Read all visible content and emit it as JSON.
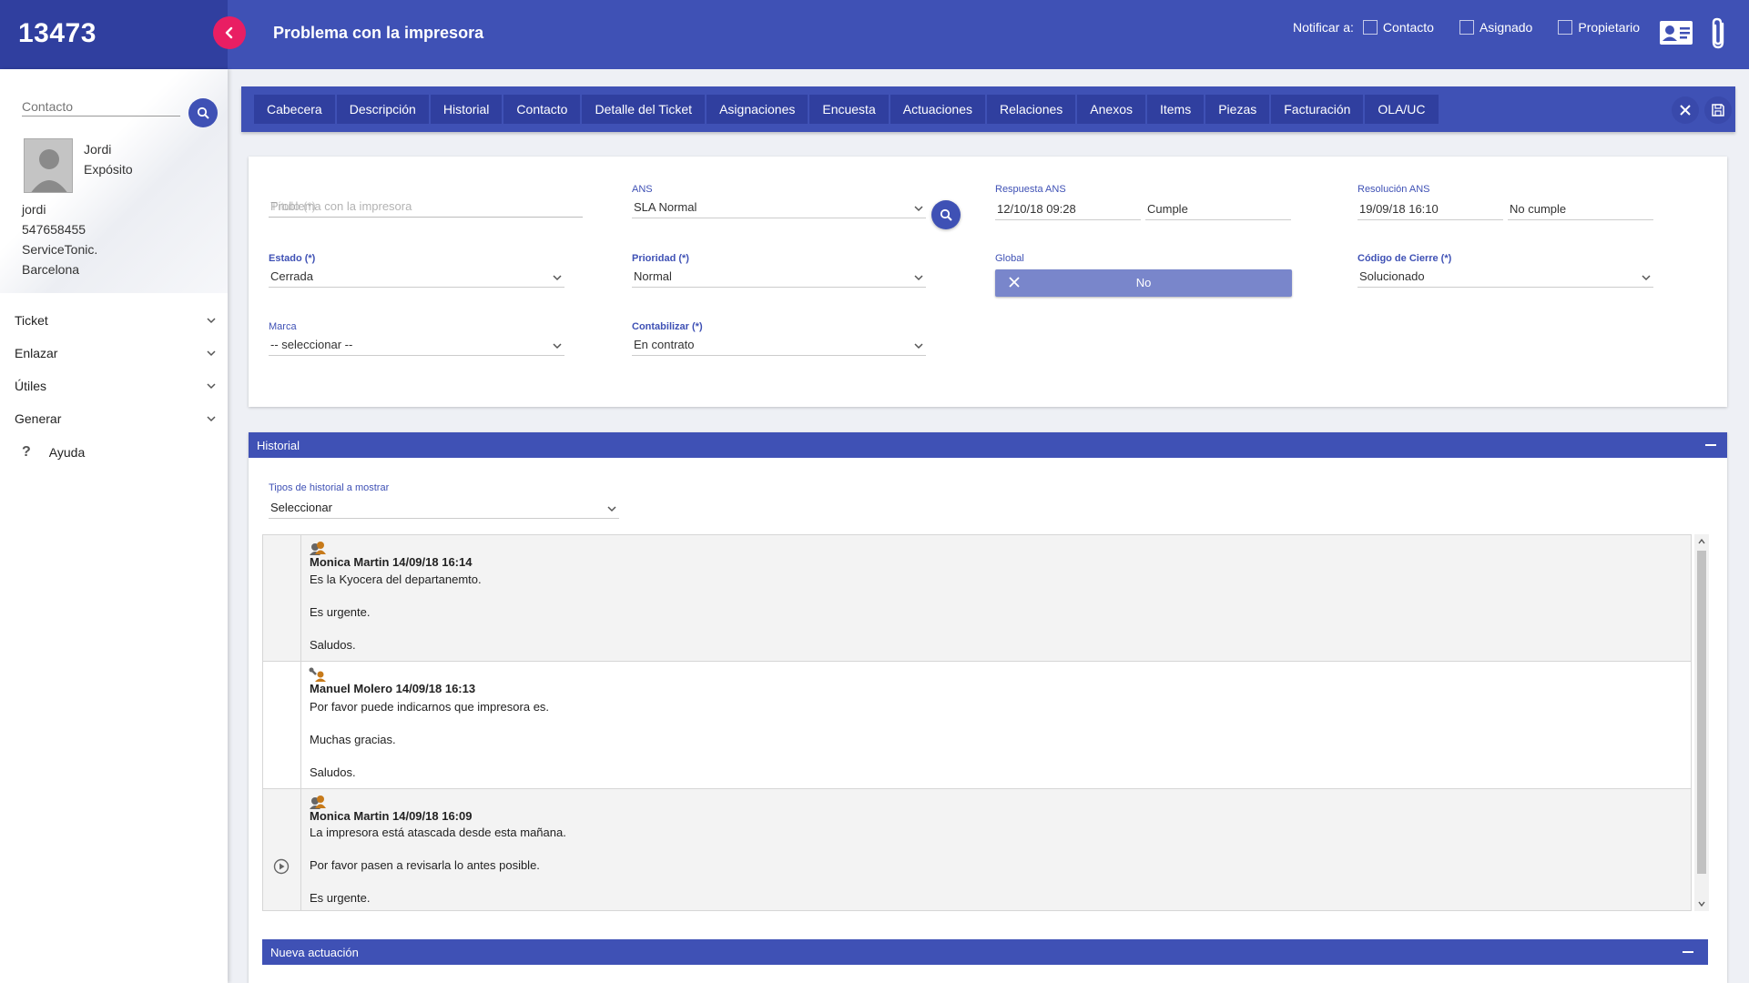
{
  "header": {
    "ticket_number": "13473",
    "title": "Problema con la impresora",
    "notify_label": "Notificar a:",
    "notify_options": [
      {
        "label": "Contacto",
        "checked": false
      },
      {
        "label": "Asignado",
        "checked": false
      },
      {
        "label": "Propietario",
        "checked": false
      }
    ]
  },
  "sidebar": {
    "contact_placeholder": "Contacto",
    "contact": {
      "first_name": "Jordi",
      "last_name": "Expósito",
      "username": "jordi",
      "phone": "547658455",
      "company": "ServiceTonic.",
      "city": "Barcelona"
    },
    "menu": [
      "Ticket",
      "Enlazar",
      "Útiles",
      "Generar"
    ],
    "help_label": "Ayuda"
  },
  "tabs": [
    "Cabecera",
    "Descripción",
    "Historial",
    "Contacto",
    "Detalle del Ticket",
    "Asignaciones",
    "Encuesta",
    "Actuaciones",
    "Relaciones",
    "Anexos",
    "Items",
    "Piezas",
    "Facturación",
    "OLA/UC"
  ],
  "form": {
    "titulo_label": "Título (*)",
    "titulo_value": "Problema con la impresora",
    "ans_label": "ANS",
    "ans_value": "SLA Normal",
    "respuesta_label": "Respuesta ANS",
    "respuesta_date": "12/10/18 09:28",
    "respuesta_status": "Cumple",
    "resolucion_label": "Resolución ANS",
    "resolucion_date": "19/09/18 16:10",
    "resolucion_status": "No cumple",
    "estado_label": "Estado (*)",
    "estado_value": "Cerrada",
    "prioridad_label": "Prioridad (*)",
    "prioridad_value": "Normal",
    "global_label": "Global",
    "global_value": "No",
    "cierre_label": "Código de Cierre (*)",
    "cierre_value": "Solucionado",
    "marca_label": "Marca",
    "marca_value": "-- seleccionar --",
    "contabilizar_label": "Contabilizar (*)",
    "contabilizar_value": "En contrato"
  },
  "historial": {
    "title": "Historial",
    "tipos_label": "Tipos de historial a mostrar",
    "tipos_value": "Seleccionar",
    "entries": [
      {
        "header": "Monica Martin 14/09/18 16:14",
        "lines": [
          "Es la Kyocera del departanemto.",
          "Es urgente.",
          "Saludos."
        ]
      },
      {
        "header": "Manuel Molero 14/09/18 16:13",
        "lines": [
          "Por favor puede indicarnos que impresora es.",
          "Muchas gracias.",
          "Saludos."
        ]
      },
      {
        "header": "Monica Martin 14/09/18 16:09",
        "lines": [
          "La impresora está atascada desde esta mañana.",
          "Por favor pasen a revisarla lo antes posible.",
          "Es urgente."
        ]
      }
    ]
  },
  "nueva": {
    "title": "Nueva actuación"
  },
  "colors": {
    "primary": "#3f51b5",
    "primary_dark": "#303f9f",
    "accent": "#e91e63",
    "toggle": "#7986cb"
  }
}
